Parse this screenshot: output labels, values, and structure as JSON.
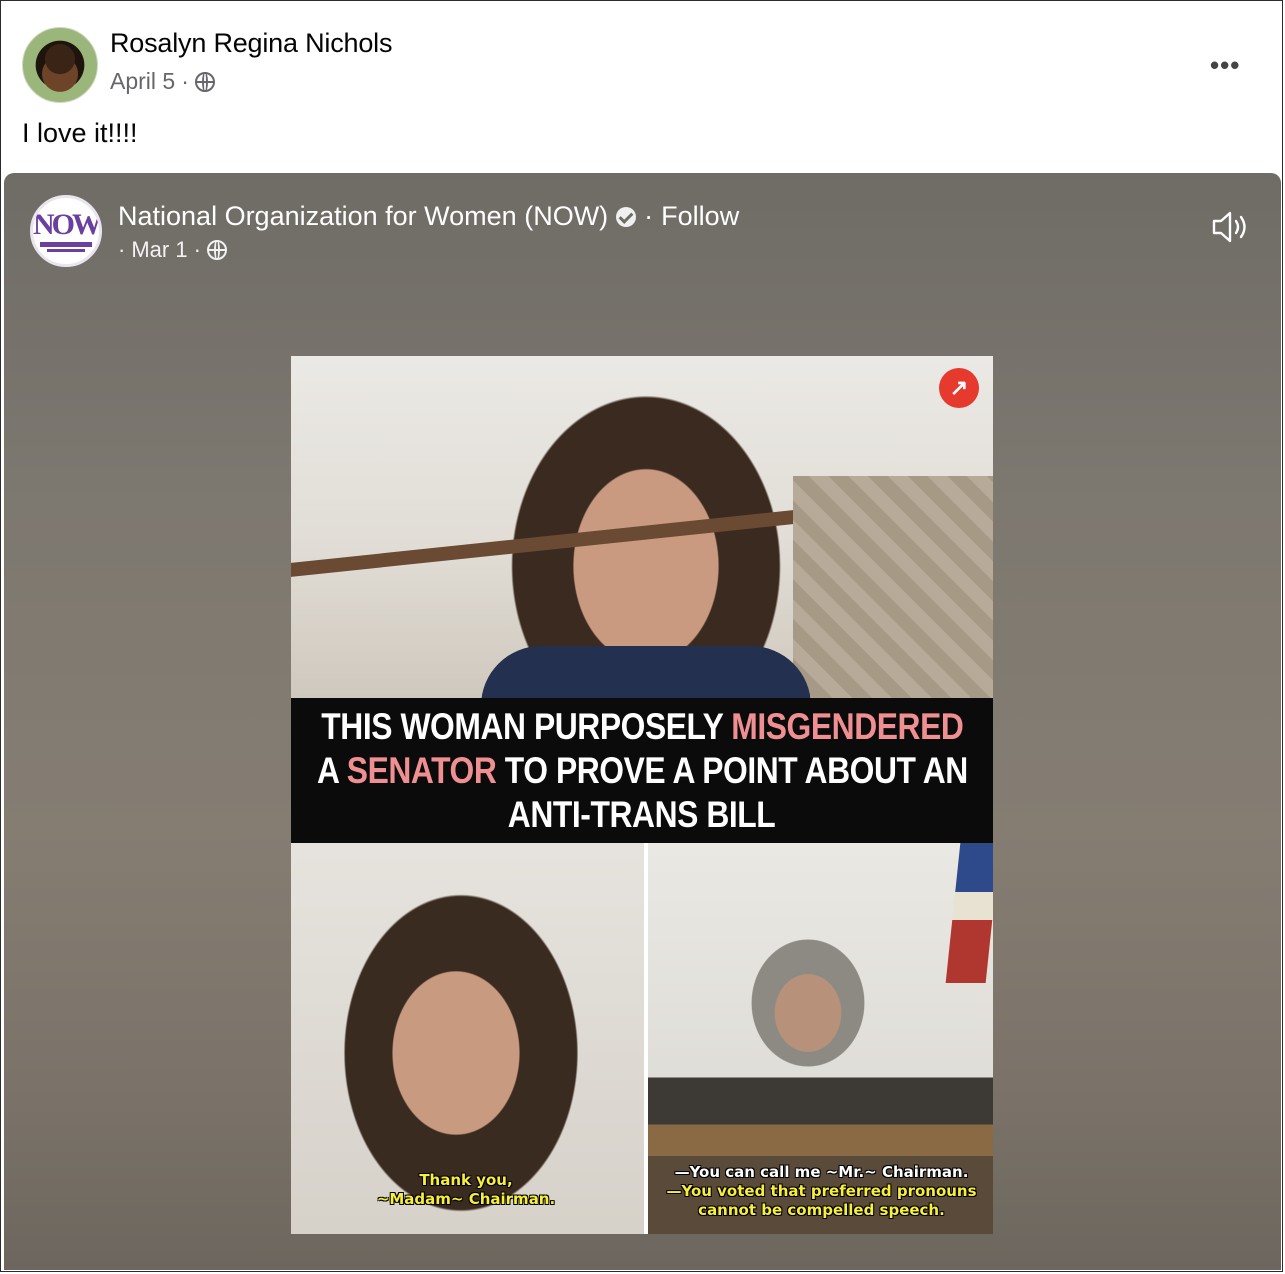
{
  "post": {
    "author": "Rosalyn Regina Nichols",
    "date": "April 5",
    "separator": "·",
    "privacy_icon": "globe-icon",
    "more_label": "•••",
    "text": "I love it!!!!"
  },
  "shared": {
    "page_name": "National Organization for Women (NOW)",
    "verified_icon": "verified-badge-icon",
    "follow_prefix": "·",
    "follow_label": "Follow",
    "date_prefix": "·",
    "date": "Mar 1",
    "separator": "·",
    "privacy_icon": "globe-icon",
    "sound_icon": "speaker-icon",
    "logo_text": "NOW"
  },
  "video": {
    "banner": {
      "line1_a": "THIS WOMAN PURPOSELY ",
      "line1_b": "MISGENDERED",
      "line2_a": "A ",
      "line2_b": "SENATOR",
      "line2_c": " TO PROVE A POINT ABOUT AN",
      "line3": "ANTI-TRANS BILL"
    },
    "caption_left": {
      "line1": "Thank you,",
      "line2": "~Madam~ Chairman."
    },
    "caption_right": {
      "line1": "—You can call me ~Mr.~ Chairman.",
      "line2": "—You voted that preferred pronouns",
      "line3": "cannot be compelled speech."
    },
    "badge_icon": "trending-icon"
  },
  "colors": {
    "card_bg": "#7d7870",
    "highlight": "#f08f92",
    "caption_yellow": "#f7ef3a",
    "now_purple": "#6b3fa0"
  }
}
